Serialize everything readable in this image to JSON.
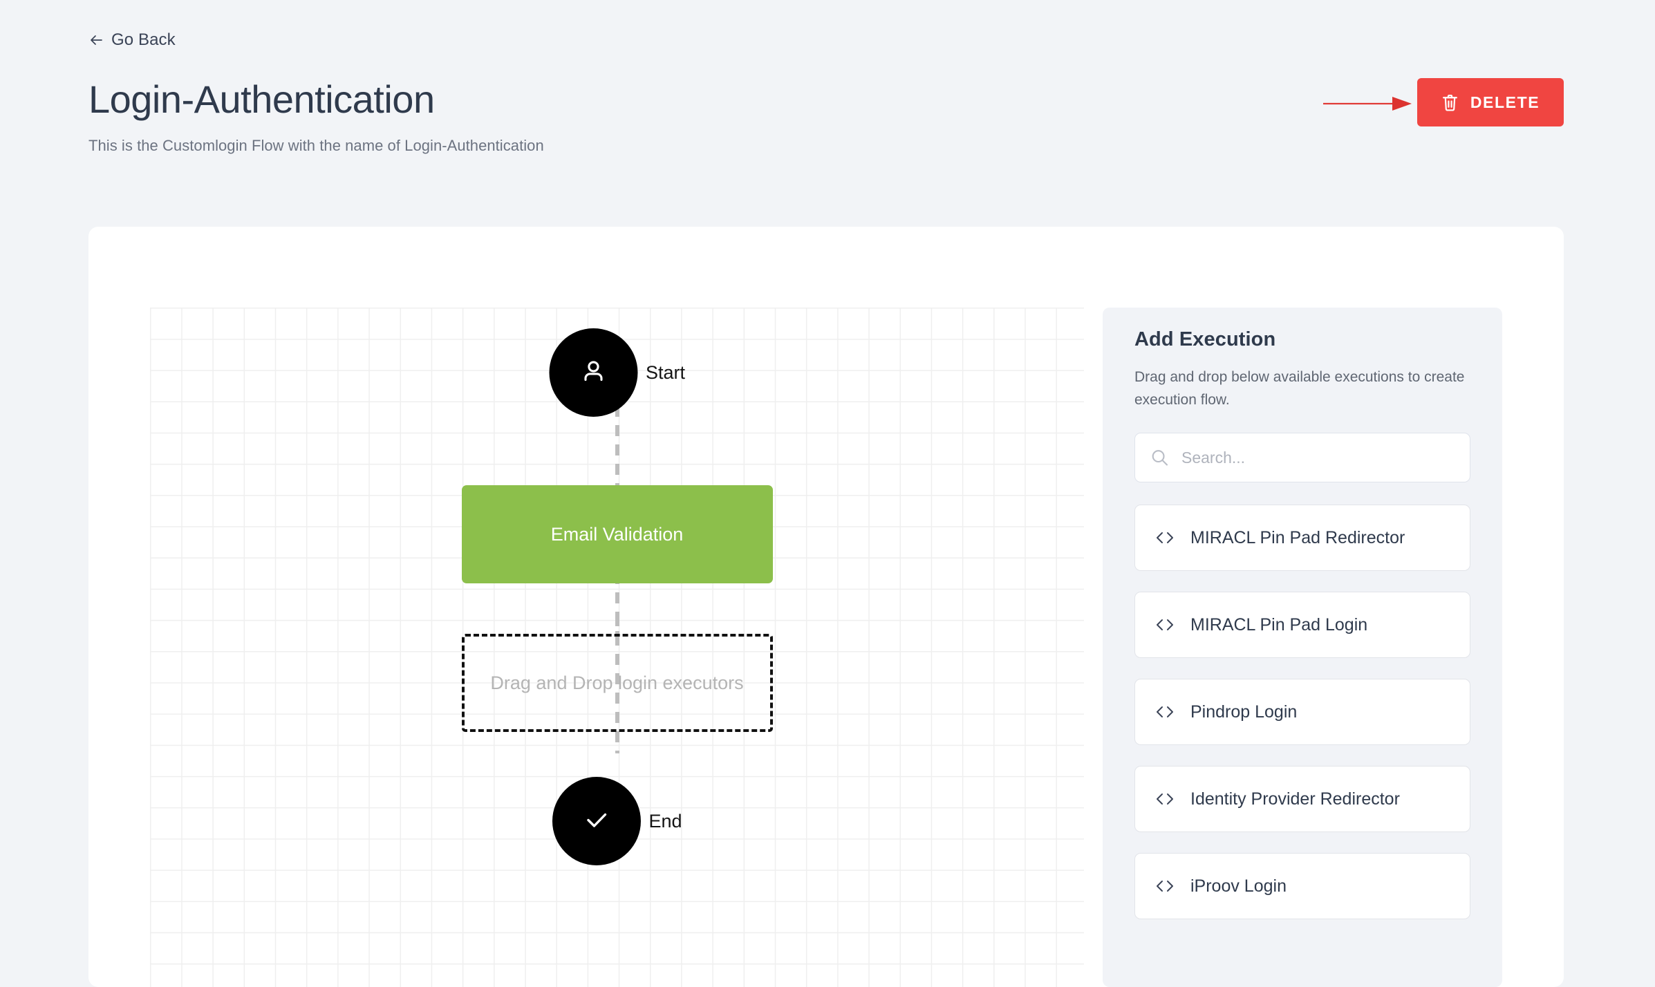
{
  "header": {
    "back_label": "Go Back",
    "title": "Login-Authentication",
    "subtitle": "This is the Customlogin Flow with the name of Login-Authentication",
    "delete_label": "DELETE"
  },
  "colors": {
    "page_background": "#F2F4F7",
    "delete_red": "#F04541",
    "annotation_red": "#E03A36",
    "node_green": "#8CBF4B",
    "node_black": "#000000",
    "panel_background": "#F1F3F7",
    "title_text": "#2F3A4C"
  },
  "flow": {
    "start": {
      "label": "Start",
      "icon": "user-icon"
    },
    "execution": {
      "label": "Email Validation"
    },
    "dropzone": {
      "label": "Drag and Drop login executors"
    },
    "end": {
      "label": "End",
      "icon": "check-icon"
    }
  },
  "panel": {
    "title": "Add Execution",
    "description": "Drag and drop below available executions to create execution flow.",
    "search": {
      "value": "",
      "placeholder": "Search..."
    },
    "items": [
      {
        "label": "MIRACL Pin Pad Redirector"
      },
      {
        "label": "MIRACL Pin Pad Login"
      },
      {
        "label": "Pindrop Login"
      },
      {
        "label": "Identity Provider Redirector"
      },
      {
        "label": "iProov Login"
      }
    ]
  }
}
